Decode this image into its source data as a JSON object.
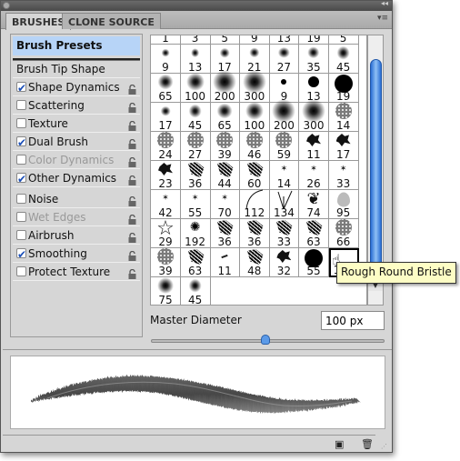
{
  "tabs": [
    {
      "label": "BRUSHES",
      "active": true
    },
    {
      "label": "CLONE SOURCE",
      "active": false
    }
  ],
  "sidebar": {
    "presets": "Brush Presets",
    "items": [
      {
        "label": "Brush Tip Shape",
        "checkbox": null,
        "lock": false,
        "enabled": true
      },
      {
        "label": "Shape Dynamics",
        "checkbox": true,
        "lock": true,
        "enabled": true
      },
      {
        "label": "Scattering",
        "checkbox": false,
        "lock": true,
        "enabled": true
      },
      {
        "label": "Texture",
        "checkbox": false,
        "lock": true,
        "enabled": true
      },
      {
        "label": "Dual Brush",
        "checkbox": true,
        "lock": true,
        "enabled": true
      },
      {
        "label": "Color Dynamics",
        "checkbox": false,
        "lock": true,
        "enabled": false
      },
      {
        "label": "Other Dynamics",
        "checkbox": true,
        "lock": true,
        "enabled": true
      },
      {
        "label": "Noise",
        "checkbox": false,
        "lock": true,
        "enabled": true
      },
      {
        "label": "Wet Edges",
        "checkbox": false,
        "lock": true,
        "enabled": false
      },
      {
        "label": "Airbrush",
        "checkbox": false,
        "lock": true,
        "enabled": true
      },
      {
        "label": "Smoothing",
        "checkbox": true,
        "lock": true,
        "enabled": true
      },
      {
        "label": "Protect Texture",
        "checkbox": false,
        "lock": true,
        "enabled": true
      }
    ]
  },
  "brush_grid": [
    [
      [
        "1",
        "none"
      ],
      [
        "3",
        "none"
      ],
      [
        "5",
        "none"
      ],
      [
        "9",
        "none"
      ],
      [
        "13",
        "none"
      ],
      [
        "19",
        "none"
      ],
      [
        "5",
        "none"
      ]
    ],
    [
      [
        "9",
        "soft"
      ],
      [
        "13",
        "soft"
      ],
      [
        "17",
        "soft"
      ],
      [
        "21",
        "soft"
      ],
      [
        "27",
        "soft"
      ],
      [
        "35",
        "soft"
      ],
      [
        "45",
        "soft"
      ]
    ],
    [
      [
        "65",
        "soft"
      ],
      [
        "100",
        "soft"
      ],
      [
        "200",
        "soft"
      ],
      [
        "300",
        "soft"
      ],
      [
        "9",
        "hard"
      ],
      [
        "13",
        "hard"
      ],
      [
        "19",
        "hard"
      ]
    ],
    [
      [
        "17",
        "soft"
      ],
      [
        "45",
        "soft"
      ],
      [
        "65",
        "soft"
      ],
      [
        "100",
        "soft"
      ],
      [
        "200",
        "soft"
      ],
      [
        "300",
        "soft"
      ],
      [
        "14",
        "splatter"
      ]
    ],
    [
      [
        "24",
        "splatter"
      ],
      [
        "27",
        "splatter"
      ],
      [
        "39",
        "splatter"
      ],
      [
        "46",
        "splatter"
      ],
      [
        "59",
        "splatter"
      ],
      [
        "11",
        "blob"
      ],
      [
        "17",
        "blob"
      ]
    ],
    [
      [
        "23",
        "blob"
      ],
      [
        "36",
        "chalk"
      ],
      [
        "44",
        "chalk"
      ],
      [
        "60",
        "chalk"
      ],
      [
        "14",
        "star"
      ],
      [
        "26",
        "star"
      ],
      [
        "33",
        "star"
      ]
    ],
    [
      [
        "42",
        "star"
      ],
      [
        "55",
        "star"
      ],
      [
        "70",
        "star"
      ],
      [
        "112",
        "curve"
      ],
      [
        "134",
        "grass"
      ],
      [
        "74",
        "maple-leaf"
      ],
      [
        "95",
        "leaf"
      ]
    ],
    [
      [
        "29",
        "star-outline"
      ],
      [
        "192",
        "starburst"
      ],
      [
        "36",
        "chalk"
      ],
      [
        "36",
        "chalk"
      ],
      [
        "33",
        "chalk"
      ],
      [
        "63",
        "chalk"
      ],
      [
        "66",
        "splatter"
      ]
    ],
    [
      [
        "39",
        "splatter"
      ],
      [
        "63",
        "chalk"
      ],
      [
        "11",
        "dash"
      ],
      [
        "48",
        "chalk"
      ],
      [
        "32",
        "blob"
      ],
      [
        "55",
        "hard"
      ],
      [
        "100",
        "bristle"
      ]
    ],
    [
      [
        "75",
        "soft"
      ],
      [
        "45",
        "soft"
      ]
    ]
  ],
  "selected_brush": {
    "row": 8,
    "col": 6
  },
  "tooltip": "Rough Round Bristle",
  "master_diameter": {
    "label": "Master Diameter",
    "value": "100 px",
    "slider_fraction": 0.49
  },
  "colors": {
    "highlight": "#b7d4f7",
    "accent": "#2b6fd4",
    "tooltip_bg": "#fdfdc5"
  },
  "footer_icons": [
    "new-brush-icon",
    "trash-icon"
  ]
}
